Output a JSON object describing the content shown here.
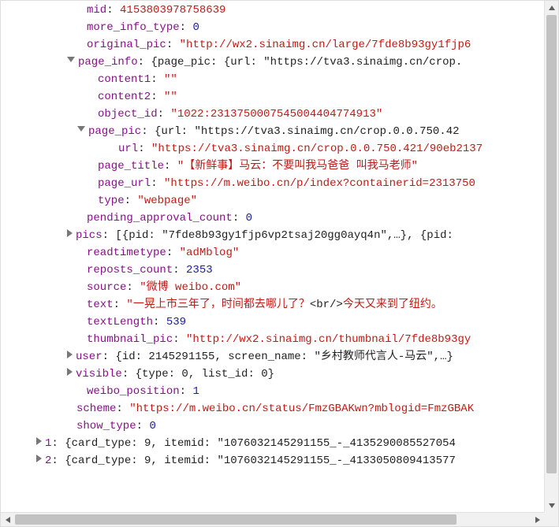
{
  "row0": {
    "key": "mid",
    "value": "4153803978758639"
  },
  "row1": {
    "key": "more_info_type",
    "value": "0"
  },
  "row2": {
    "key": "original_pic",
    "value": "\"http://wx2.sinaimg.cn/large/7fde8b93gy1fjp6"
  },
  "row3": {
    "key": "page_info",
    "summary": "{page_pic: {url: \"https://tva3.sinaimg.cn/crop."
  },
  "row4": {
    "key": "content1",
    "value": "\"\""
  },
  "row5": {
    "key": "content2",
    "value": "\"\""
  },
  "row6": {
    "key": "object_id",
    "value": "\"1022:2313750007545004404774913\""
  },
  "row7": {
    "key": "page_pic",
    "summary": "{url: \"https://tva3.sinaimg.cn/crop.0.0.750.42"
  },
  "row8": {
    "key": "url",
    "value": "\"https://tva3.sinaimg.cn/crop.0.0.750.421/90eb2137"
  },
  "row9": {
    "key": "page_title",
    "value": "\"【新鲜事】马云：不要叫我马爸爸  叫我马老师\""
  },
  "row10": {
    "key": "page_url",
    "value": "\"https://m.weibo.cn/p/index?containerid=2313750"
  },
  "row11": {
    "key": "type",
    "value": "\"webpage\""
  },
  "row12": {
    "key": "pending_approval_count",
    "value": "0"
  },
  "row13": {
    "key": "pics",
    "summary": "[{pid: \"7fde8b93gy1fjp6vp2tsaj20gg0ayq4n\",…}, {pid:"
  },
  "row14": {
    "key": "readtimetype",
    "value": "\"adMblog\""
  },
  "row15": {
    "key": "reposts_count",
    "value": "2353"
  },
  "row16": {
    "key": "source",
    "value": "\"微博 weibo.com\""
  },
  "row17": {
    "key": "text",
    "valuePre": "\"一晃上市三年了，时间都去哪儿了？",
    "tag": "<br/>",
    "valuePost": "今天又来到了纽约。"
  },
  "row18": {
    "key": "textLength",
    "value": "539"
  },
  "row19": {
    "key": "thumbnail_pic",
    "value": "\"http://wx2.sinaimg.cn/thumbnail/7fde8b93gy"
  },
  "row20": {
    "key": "user",
    "summary": "{id: 2145291155, screen_name: \"乡村教师代言人-马云\",…}"
  },
  "row21": {
    "key": "visible",
    "summary": "{type: 0, list_id: 0}"
  },
  "row22": {
    "key": "weibo_position",
    "value": "1"
  },
  "row23": {
    "key": "scheme",
    "value": "\"https://m.weibo.cn/status/FmzGBAKwn?mblogid=FmzGBAK"
  },
  "row24": {
    "key": "show_type",
    "value": "0"
  },
  "row25": {
    "key": "1",
    "summary": "{card_type: 9, itemid: \"1076032145291155_-_4135290085527054"
  },
  "row26": {
    "key": "2",
    "summary": "{card_type: 9, itemid: \"1076032145291155_-_4133050809413577"
  }
}
